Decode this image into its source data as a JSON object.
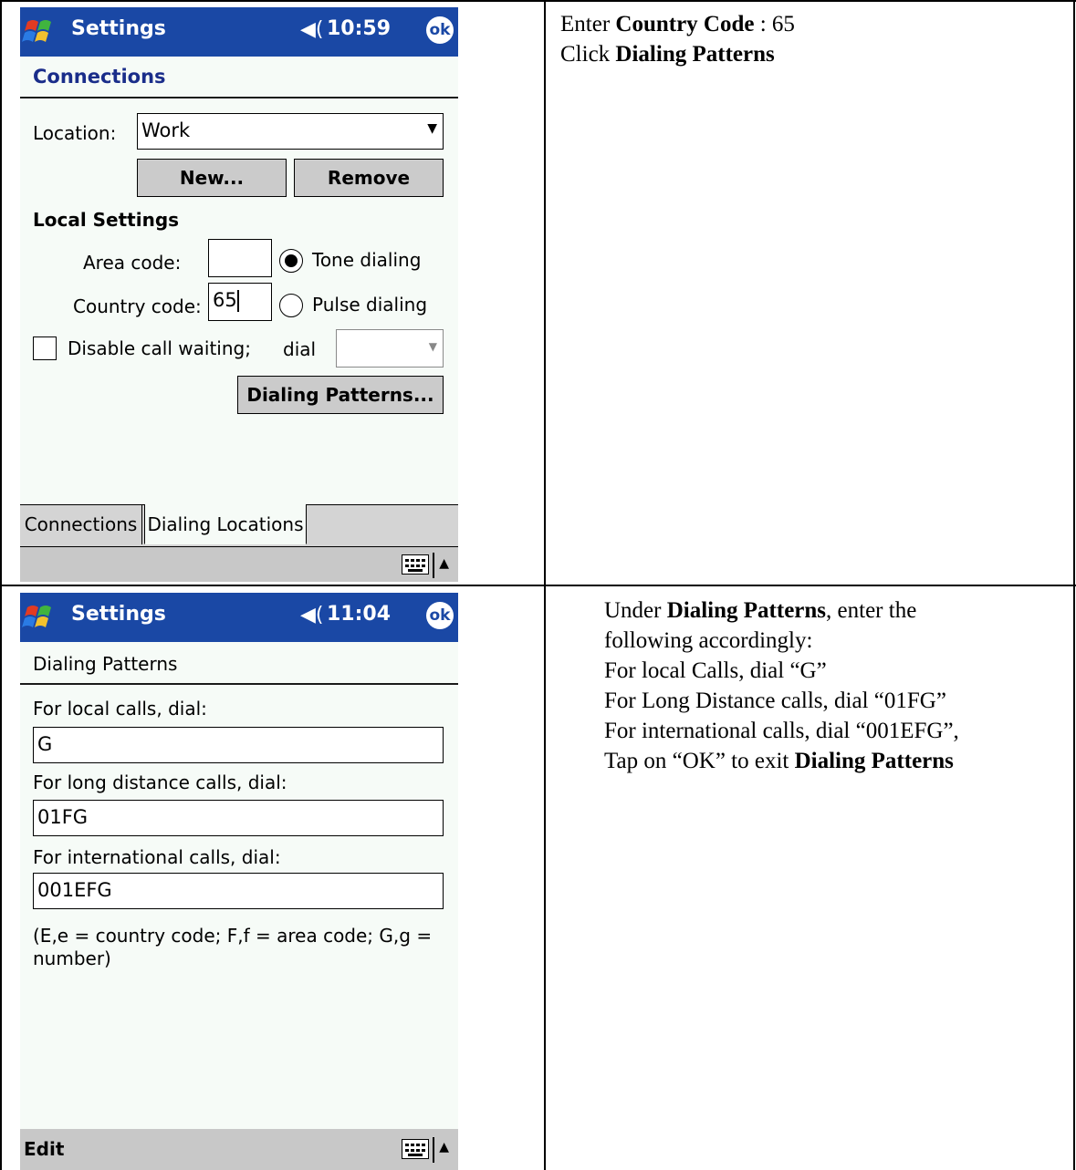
{
  "screen1": {
    "title": "Settings",
    "time": "10:59",
    "ok_label": "ok",
    "page_heading": "Connections",
    "location_label": "Location:",
    "location_value": "Work",
    "new_button": "New...",
    "remove_button": "Remove",
    "local_settings_heading": "Local Settings",
    "area_code_label": "Area code:",
    "area_code_value": "",
    "country_code_label": "Country code:",
    "country_code_value": "65",
    "tone_dialing_label": "Tone dialing",
    "pulse_dialing_label": "Pulse dialing",
    "disable_call_waiting_label": "Disable call waiting;",
    "dial_label": "dial",
    "dial_value": "",
    "dialing_patterns_button": "Dialing Patterns...",
    "tabs": [
      "Connections",
      "Dialing Locations"
    ]
  },
  "screen2": {
    "title": "Settings",
    "time": "11:04",
    "ok_label": "ok",
    "page_heading": "Dialing Patterns",
    "local_label": "For local calls, dial:",
    "local_value": "G",
    "long_distance_label": "For long distance calls, dial:",
    "long_distance_value": "01FG",
    "international_label": "For international calls, dial:",
    "international_value": "001EFG",
    "legend_text_line1": "(E,e = country code; F,f = area code; G,g =",
    "legend_text_line2": "number)",
    "menu_edit": "Edit"
  },
  "instructions1": {
    "line1_prefix": "Enter ",
    "line1_bold": "Country Code",
    "line1_suffix": " : 65",
    "line2_prefix": "Click ",
    "line2_bold": "Dialing Patterns"
  },
  "instructions2": {
    "line1_prefix": "Under ",
    "line1_bold": "Dialing Patterns",
    "line1_suffix": ", enter the",
    "line2": "following accordingly:",
    "line3": "For local Calls, dial “G”",
    "line4": "For Long Distance calls, dial “01FG”",
    "line5": "For international calls, dial “001EFG”,",
    "line6_prefix": "Tap on “OK” to exit ",
    "line6_bold": "Dialing Patterns"
  },
  "colors": {
    "titlebar": "#1a48a5",
    "heading": "#1a2d8a",
    "screen_background": "#f6fbf7"
  }
}
